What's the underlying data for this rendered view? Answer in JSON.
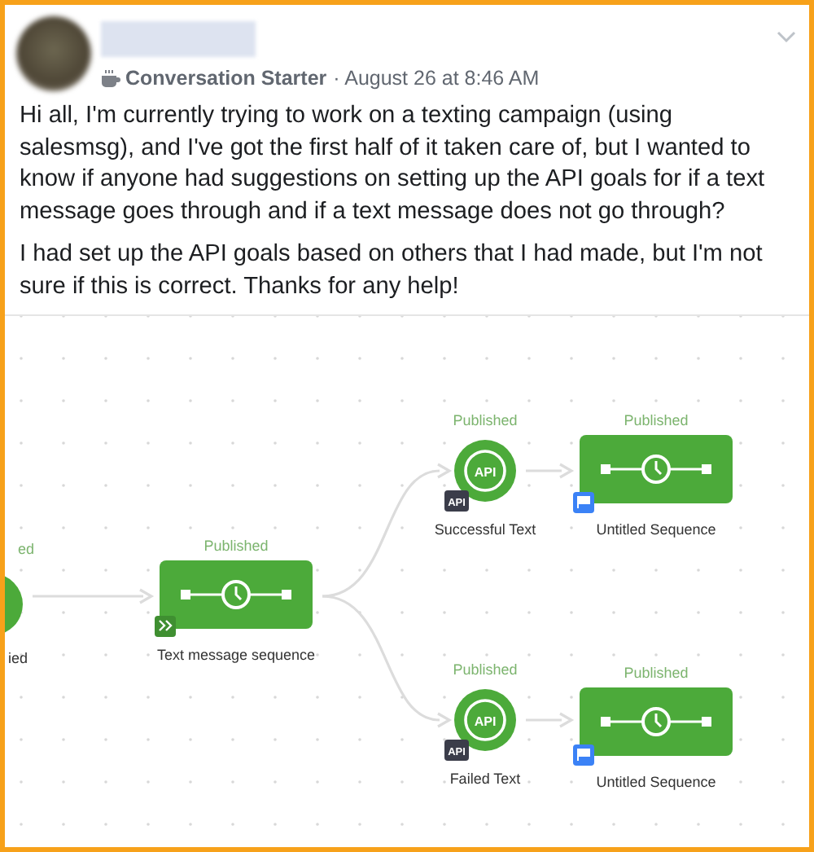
{
  "post": {
    "badge": "Conversation Starter",
    "timestamp": "· August 26 at 8:46 AM",
    "paragraphs": [
      "Hi all, I'm currently trying to work on a texting campaign (using salesmsg), and I've got the first half of it taken care of, but I wanted to know if anyone had suggestions on setting up the API goals for if a text message goes through and if a text message does not go through?",
      "I had set up the API goals based on others that I had made, but I'm not sure if this is correct. Thanks for any help!"
    ]
  },
  "diagram": {
    "nodes": [
      {
        "kind": "circle",
        "status": "ed",
        "label": "ied"
      },
      {
        "kind": "sequence",
        "status": "Published",
        "label": "Text message sequence",
        "badge": {
          "kind": "action"
        }
      },
      {
        "kind": "api",
        "status": "Published",
        "label": "Successful Text",
        "icon_text": "API",
        "badge": "API"
      },
      {
        "kind": "sequence",
        "status": "Published",
        "label": "Untitled Sequence",
        "badge": {
          "kind": "flag"
        }
      },
      {
        "kind": "api",
        "status": "Published",
        "label": "Failed Text",
        "icon_text": "API",
        "badge": "API"
      },
      {
        "kind": "sequence",
        "status": "Published",
        "label": "Untitled Sequence",
        "badge": {
          "kind": "flag"
        }
      }
    ]
  }
}
